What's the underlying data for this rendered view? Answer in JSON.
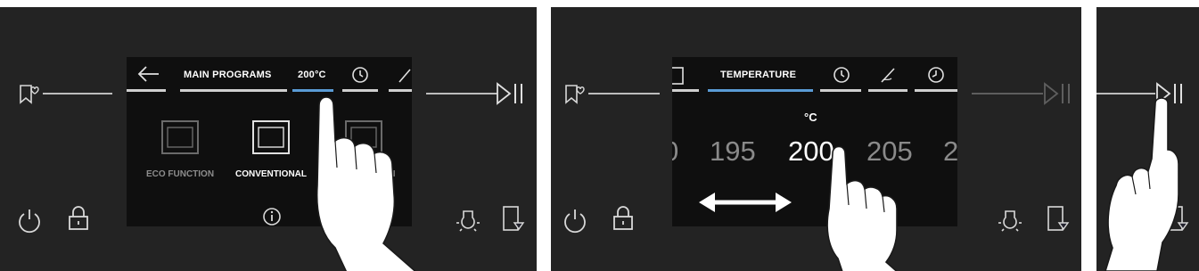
{
  "panel1": {
    "header": {
      "back_icon": "arrow-left-icon",
      "title": "MAIN PROGRAMS",
      "temp_tab": "200°C",
      "clock_icon": "clock-icon",
      "probe_icon": "probe-icon"
    },
    "programs": [
      {
        "label": "ECO FUNCTION",
        "icon": "oven-icon"
      },
      {
        "label": "CONVENTIONAL",
        "icon": "oven-icon"
      },
      {
        "label": "ON",
        "icon": "oven-icon"
      }
    ],
    "info_icon": "info-icon"
  },
  "panel2": {
    "header": {
      "title": "TEMPERATURE"
    },
    "unit": "°C",
    "values": [
      "0",
      "195",
      "200",
      "205",
      "2"
    ],
    "selected": "200"
  },
  "colors": {
    "panel": "#232323",
    "screen": "#0f0f0f",
    "accent": "#5a9bd5",
    "text": "#ffffff",
    "dim": "#8a8a8a"
  }
}
